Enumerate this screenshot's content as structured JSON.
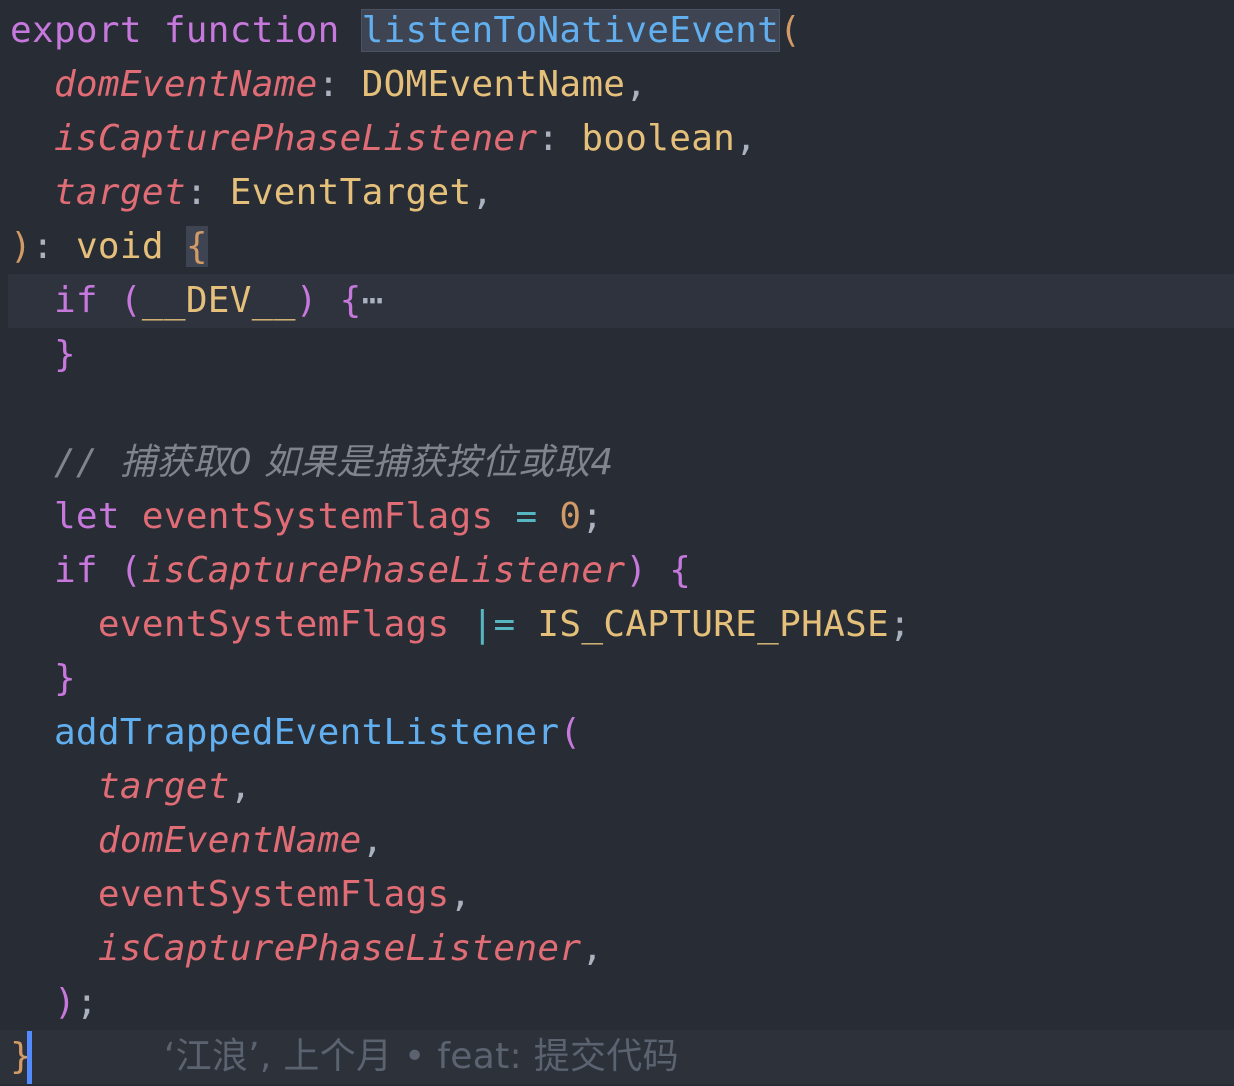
{
  "editor": {
    "language": "typescript",
    "lines": [
      {
        "tokens": [
          [
            "export",
            "kw"
          ],
          [
            " ",
            "punct"
          ],
          [
            "function",
            "kw"
          ],
          [
            " ",
            "punct"
          ],
          [
            "listenToNativeEvent",
            "fn-sel"
          ],
          [
            "(",
            "paren"
          ]
        ]
      },
      {
        "tokens": [
          [
            "  ",
            "punct"
          ],
          [
            "domEventName",
            "param"
          ],
          [
            ": ",
            "punct"
          ],
          [
            "DOMEventName",
            "type"
          ],
          [
            ",",
            "punct"
          ]
        ]
      },
      {
        "tokens": [
          [
            "  ",
            "punct"
          ],
          [
            "isCapturePhaseListener",
            "param"
          ],
          [
            ": ",
            "punct"
          ],
          [
            "boolean",
            "type"
          ],
          [
            ",",
            "punct"
          ]
        ]
      },
      {
        "tokens": [
          [
            "  ",
            "punct"
          ],
          [
            "target",
            "param"
          ],
          [
            ": ",
            "punct"
          ],
          [
            "EventTarget",
            "type"
          ],
          [
            ",",
            "punct"
          ]
        ]
      },
      {
        "tokens": [
          [
            ")",
            "paren"
          ],
          [
            ": ",
            "punct"
          ],
          [
            "void",
            "type"
          ],
          [
            " ",
            "punct"
          ],
          [
            "{",
            "paren-match"
          ]
        ]
      },
      {
        "tokens": [
          [
            "  ",
            "punct"
          ],
          [
            "if",
            "kw"
          ],
          [
            " ",
            "punct"
          ],
          [
            "(",
            "paren2"
          ],
          [
            "__DEV__",
            "type"
          ],
          [
            ")",
            "paren2"
          ],
          [
            " ",
            "punct"
          ],
          [
            "{",
            "paren2"
          ],
          [
            "⋯",
            "ellipsis"
          ]
        ],
        "highlight": true
      },
      {
        "tokens": [
          [
            "  ",
            "punct"
          ],
          [
            "}",
            "paren2"
          ]
        ]
      },
      {
        "tokens": []
      },
      {
        "tokens": [
          [
            "  ",
            "punct"
          ],
          [
            "// ",
            "comment"
          ],
          [
            "捕获取0 如果是捕获按位或取4",
            "comment-cjk"
          ]
        ]
      },
      {
        "tokens": [
          [
            "  ",
            "punct"
          ],
          [
            "let",
            "kw"
          ],
          [
            " ",
            "punct"
          ],
          [
            "eventSystemFlags",
            "var"
          ],
          [
            " ",
            "punct"
          ],
          [
            "=",
            "op"
          ],
          [
            " ",
            "punct"
          ],
          [
            "0",
            "num"
          ],
          [
            ";",
            "punct"
          ]
        ]
      },
      {
        "tokens": [
          [
            "  ",
            "punct"
          ],
          [
            "if",
            "kw"
          ],
          [
            " ",
            "punct"
          ],
          [
            "(",
            "paren2"
          ],
          [
            "isCapturePhaseListener",
            "param"
          ],
          [
            ")",
            "paren2"
          ],
          [
            " ",
            "punct"
          ],
          [
            "{",
            "paren2"
          ]
        ]
      },
      {
        "tokens": [
          [
            "    ",
            "punct"
          ],
          [
            "eventSystemFlags",
            "var"
          ],
          [
            " ",
            "punct"
          ],
          [
            "|=",
            "op"
          ],
          [
            " ",
            "punct"
          ],
          [
            "IS_CAPTURE_PHASE",
            "const"
          ],
          [
            ";",
            "punct"
          ]
        ]
      },
      {
        "tokens": [
          [
            "  ",
            "punct"
          ],
          [
            "}",
            "paren2"
          ]
        ]
      },
      {
        "tokens": [
          [
            "  ",
            "punct"
          ],
          [
            "addTrappedEventListener",
            "fn"
          ],
          [
            "(",
            "paren2"
          ]
        ]
      },
      {
        "tokens": [
          [
            "    ",
            "punct"
          ],
          [
            "target",
            "param"
          ],
          [
            ",",
            "punct"
          ]
        ]
      },
      {
        "tokens": [
          [
            "    ",
            "punct"
          ],
          [
            "domEventName",
            "param"
          ],
          [
            ",",
            "punct"
          ]
        ]
      },
      {
        "tokens": [
          [
            "    ",
            "punct"
          ],
          [
            "eventSystemFlags",
            "var"
          ],
          [
            ",",
            "punct"
          ]
        ]
      },
      {
        "tokens": [
          [
            "    ",
            "punct"
          ],
          [
            "isCapturePhaseListener",
            "param"
          ],
          [
            ",",
            "punct"
          ]
        ]
      },
      {
        "tokens": [
          [
            "  ",
            "punct"
          ],
          [
            ")",
            "paren2"
          ],
          [
            ";",
            "punct"
          ]
        ]
      },
      {
        "tokens": [
          [
            "}",
            "paren"
          ],
          [
            "      ",
            "punct"
          ],
          [
            "‘江浪’, 上个月 • feat: 提交代码",
            "blame"
          ]
        ],
        "current": true
      }
    ]
  },
  "colors": {
    "background": "#282c34",
    "keyword": "#c678dd",
    "function": "#61afef",
    "parameter": "#e06c75",
    "type": "#e5c07b",
    "comment": "#7f848e",
    "cursor": "#528bff"
  }
}
